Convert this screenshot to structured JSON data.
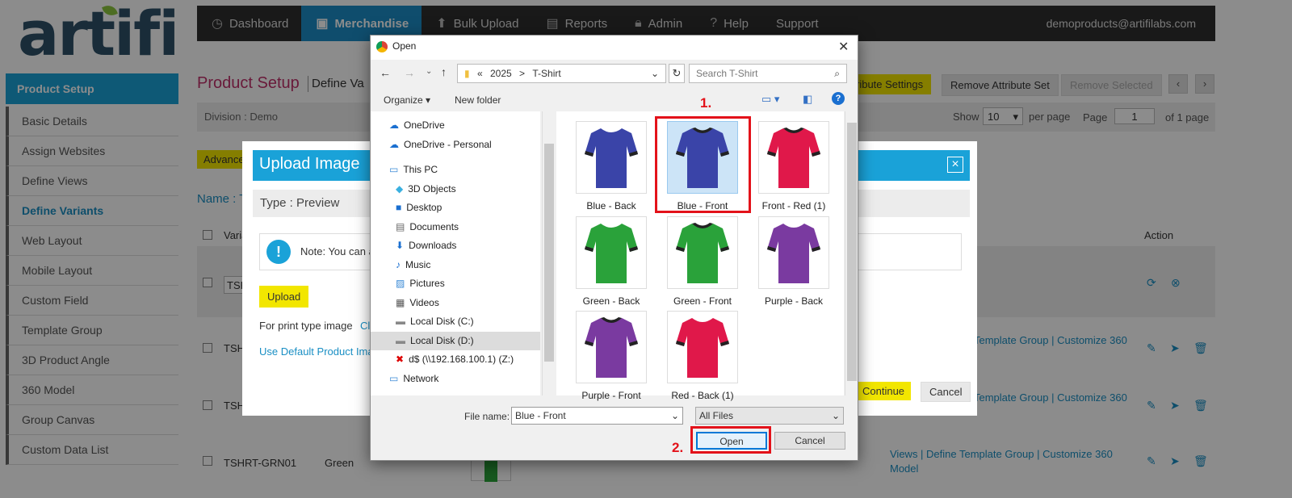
{
  "logo": {
    "text": "artifi"
  },
  "topnav": {
    "items": [
      {
        "label": "Dashboard",
        "icon": "dashboard-icon"
      },
      {
        "label": "Merchandise",
        "icon": "bag-icon"
      },
      {
        "label": "Bulk Upload",
        "icon": "upload-icon"
      },
      {
        "label": "Reports",
        "icon": "document-icon"
      },
      {
        "label": "Admin",
        "icon": "lock-icon"
      },
      {
        "label": "Help",
        "icon": "help-icon"
      },
      {
        "label": "Support",
        "icon": ""
      }
    ],
    "user": "demoproducts@artifilabs.com"
  },
  "sidebar": {
    "header": "Product Setup",
    "items": [
      "Basic Details",
      "Assign Websites",
      "Define Views",
      "Define Variants",
      "Web Layout",
      "Mobile Layout",
      "Custom Field",
      "Template Group",
      "3D Product Angle",
      "360 Model",
      "Group Canvas",
      "Custom Data List"
    ],
    "selected": "Define Variants"
  },
  "page": {
    "title": "Product Setup",
    "subtitle": "Define Va",
    "buttons": {
      "attr_settings": "ribute Settings",
      "remove_attr_set": "Remove Attribute Set",
      "remove_selected": "Remove Selected"
    },
    "division": "Division :  Demo",
    "show_label": "Show",
    "per_page_value": "10",
    "per_page_label": "per page",
    "page_label": "Page",
    "page_value": "1",
    "of_pages": "of 1 page",
    "advance": "Advance",
    "name_label": "Name : T",
    "col_variant": "Varia",
    "col_action": "Action"
  },
  "table": {
    "rows": [
      {
        "code": "TSH",
        "color": "",
        "links": ""
      },
      {
        "code": "TSH",
        "color": "",
        "links": "Template Group | Customize 360"
      },
      {
        "code": "TSH",
        "color": "",
        "links": "Template Group | Customize 360"
      },
      {
        "code": "TSHRT-GRN01",
        "color": "Green",
        "links": "Views | Define Template Group | Customize 360",
        "links2": "Model"
      }
    ]
  },
  "modal": {
    "title": "Upload Image",
    "type_label": "Type : Preview",
    "note": "Note: You can a",
    "upload_btn": "Upload",
    "print_text": "For print type image",
    "print_link": "Cl",
    "default_link": "Use Default Product Ima",
    "continue_btn": "Continue",
    "cancel_btn": "Cancel"
  },
  "dialog": {
    "title": "Open",
    "breadcrumb": [
      "«",
      "2025",
      ">",
      "T-Shirt"
    ],
    "search_placeholder": "Search T-Shirt",
    "organize": "Organize",
    "new_folder": "New folder",
    "tree": [
      {
        "label": "OneDrive",
        "icon": "cloud-icon",
        "indent": 0
      },
      {
        "label": "OneDrive - Personal",
        "icon": "cloud-icon",
        "indent": 0
      },
      {
        "label": "This PC",
        "icon": "computer-icon",
        "indent": 0
      },
      {
        "label": "3D Objects",
        "icon": "cube-icon",
        "indent": 1
      },
      {
        "label": "Desktop",
        "icon": "desktop-icon",
        "indent": 1
      },
      {
        "label": "Documents",
        "icon": "document-icon",
        "indent": 1
      },
      {
        "label": "Downloads",
        "icon": "download-icon",
        "indent": 1
      },
      {
        "label": "Music",
        "icon": "music-icon",
        "indent": 1
      },
      {
        "label": "Pictures",
        "icon": "pictures-icon",
        "indent": 1
      },
      {
        "label": "Videos",
        "icon": "video-icon",
        "indent": 1
      },
      {
        "label": "Local Disk (C:)",
        "icon": "disk-icon",
        "indent": 1
      },
      {
        "label": "Local Disk (D:)",
        "icon": "disk-icon",
        "indent": 1
      },
      {
        "label": "d$ (\\\\192.168.100.1) (Z:)",
        "icon": "network-drive-icon",
        "indent": 1
      },
      {
        "label": "Network",
        "icon": "network-icon",
        "indent": 0
      }
    ],
    "tree_selected": "Local Disk (D:)",
    "files": [
      {
        "name": "Blue - Back",
        "color": "#3a44a8",
        "collar": false
      },
      {
        "name": "Blue - Front",
        "color": "#3a44a8",
        "collar": true
      },
      {
        "name": "Front - Red (1)",
        "color": "#e0184a",
        "collar": true
      },
      {
        "name": "Green - Back",
        "color": "#2aa23a",
        "collar": false
      },
      {
        "name": "Green - Front",
        "color": "#2aa23a",
        "collar": true
      },
      {
        "name": "Purple - Back",
        "color": "#7a3aa0",
        "collar": false
      },
      {
        "name": "Purple - Front",
        "color": "#7a3aa0",
        "collar": true
      },
      {
        "name": "Red - Back (1)",
        "color": "#e0184a",
        "collar": false
      }
    ],
    "file_selected": "Blue - Front",
    "filename_label": "File name:",
    "filename_value": "Blue - Front",
    "filetype": "All Files",
    "open_btn": "Open",
    "cancel_btn": "Cancel"
  },
  "annotations": {
    "step1": "1.",
    "step2": "2."
  }
}
